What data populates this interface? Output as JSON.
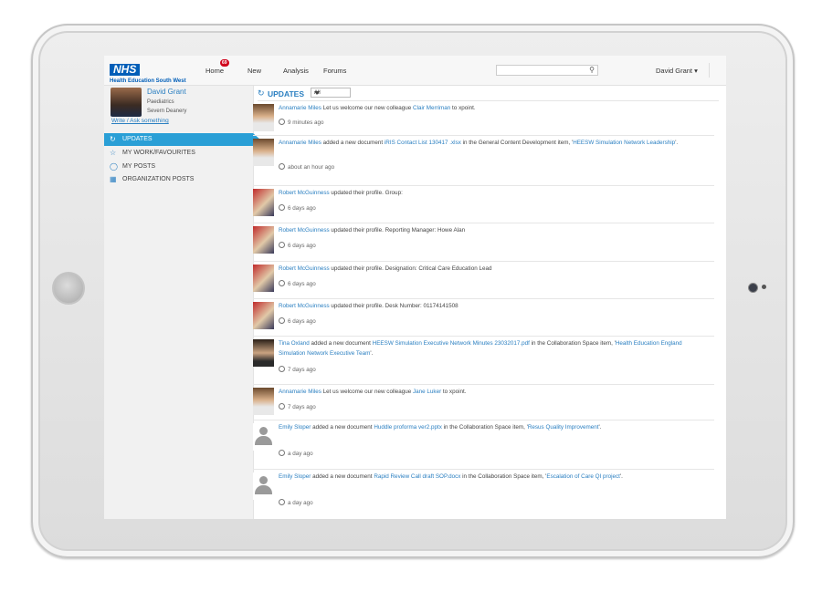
{
  "nav": {
    "logo_mark": "NHS",
    "logo_sub": "Health Education South West",
    "home": "Home",
    "home_badge": "69",
    "new": "New",
    "analysis": "Analysis",
    "forums": "Forums",
    "search_placeholder": "",
    "user": "David Grant ▾"
  },
  "profile": {
    "name": "David Grant",
    "dept": "Paediatrics",
    "deanery": "Severn Deanery",
    "write_link": "Write / Ask something"
  },
  "sidebar": {
    "items": [
      {
        "label": "UPDATES",
        "icon": "refresh-icon"
      },
      {
        "label": "MY WORK/FAVOURITES",
        "icon": "star-icon"
      },
      {
        "label": "MY POSTS",
        "icon": "speech-bubble-icon"
      },
      {
        "label": "ORGANIZATION POSTS",
        "icon": "building-icon"
      }
    ]
  },
  "feed": {
    "title": "UPDATES",
    "filter": "All",
    "posts": [
      {
        "actor": "Annamarie Miles",
        "text": " Let us welcome our new colleague ",
        "link1": "Clair Merriman",
        "text2": " to xpoint.",
        "time": "9 minutes ago"
      },
      {
        "actor": "Annamarie Miles",
        "text": " added a new document ",
        "link1": "iRIS Contact List 130417 .xlsx",
        "text2": " in the General Content Development item, '",
        "link2": "HEESW Simulation Network Leadership",
        "text3": "'.",
        "time": "about an hour ago"
      },
      {
        "actor": "Robert McGuinness",
        "text": " updated their profile. Group:",
        "time": "6 days ago"
      },
      {
        "actor": "Robert McGuinness",
        "text": " updated their profile. Reporting Manager: Howe Alan",
        "time": "6 days ago"
      },
      {
        "actor": "Robert McGuinness",
        "text": " updated their profile. Designation: Critical Care Education Lead",
        "time": "6 days ago"
      },
      {
        "actor": "Robert McGuinness",
        "text": " updated their profile. Desk Number: 01174141508",
        "time": "6 days ago"
      },
      {
        "actor": "Tina Oxland",
        "text": " added a new document ",
        "link1": "HEESW Simulation Executive Network Minutes 23032017.pdf",
        "text2": " in the Collaboration Space item, '",
        "link2": "Health Education England Simulation Network Executive Team",
        "text3": "'.",
        "time": "7 days ago"
      },
      {
        "actor": "Annamarie Miles",
        "text": " Let us welcome our new colleague ",
        "link1": "Jane Luker",
        "text2": " to xpoint.",
        "time": "7 days ago"
      },
      {
        "actor": "Emily Sloper",
        "text": " added a new document ",
        "link1": "Huddle proforma ver2.pptx",
        "text2": " in the Collaboration Space item, '",
        "link2": "Resus Quality Improvement",
        "text3": "'.",
        "time": "a day ago"
      },
      {
        "actor": "Emily Sloper",
        "text": " added a new document ",
        "link1": "Rapid Review Call draft SOP.docx",
        "text2": " in the Collaboration Space item, '",
        "link2": "Escalation of Care QI project",
        "text3": "'.",
        "time": "a day ago"
      }
    ]
  }
}
